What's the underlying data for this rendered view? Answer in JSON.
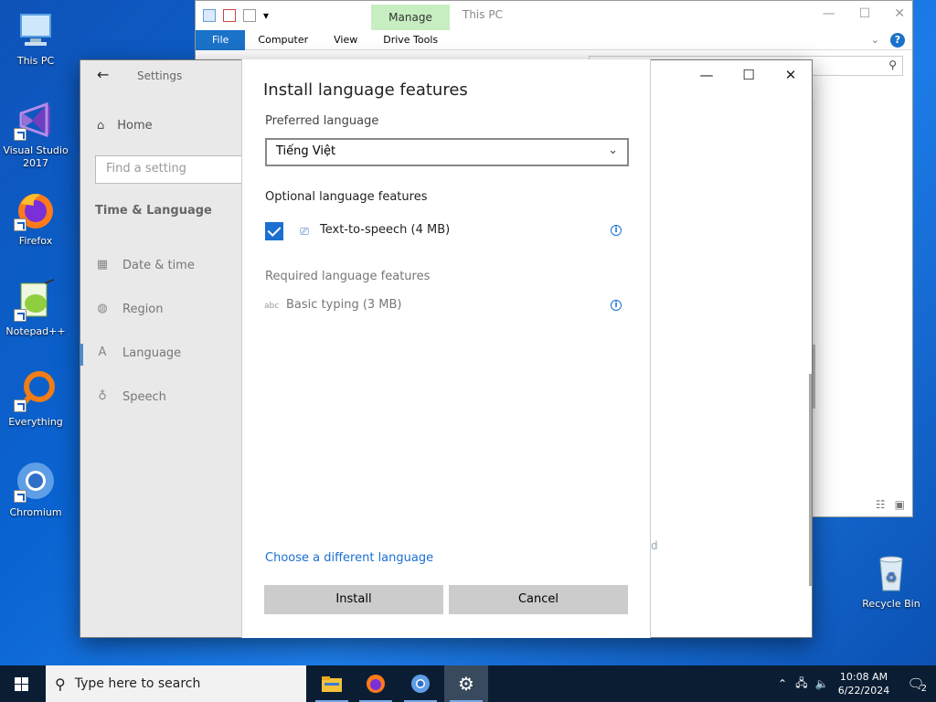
{
  "desktop": {
    "icons": [
      {
        "label": "This PC"
      },
      {
        "label": "Visual Studio 2017"
      },
      {
        "label": "Firefox"
      },
      {
        "label": "Notepad++"
      },
      {
        "label": "Everything"
      },
      {
        "label": "Chromium"
      },
      {
        "label": "Recycle Bin"
      }
    ]
  },
  "explorer": {
    "manage_tab": "Manage",
    "title": "This PC",
    "tabs": [
      "File",
      "Computer",
      "View",
      "Drive Tools"
    ],
    "help": "?"
  },
  "settings": {
    "window_title": "Settings",
    "home": "Home",
    "search_placeholder": "Find a setting",
    "category": "Time & Language",
    "nav": [
      "Date & time",
      "Region",
      "Language",
      "Speech"
    ],
    "selected": "Language",
    "bg_hint": "d"
  },
  "dialog": {
    "title": "Install language features",
    "preferred_label": "Preferred language",
    "preferred_value": "Tiếng Việt",
    "optional_label": "Optional language features",
    "optional_items": [
      {
        "label": "Text-to-speech (4 MB)",
        "checked": true
      }
    ],
    "required_label": "Required language features",
    "required_items": [
      {
        "label": "Basic typing (3 MB)"
      }
    ],
    "link": "Choose a different language",
    "install": "Install",
    "cancel": "Cancel"
  },
  "taskbar": {
    "search_placeholder": "Type here to search",
    "time": "10:08 AM",
    "date": "6/22/2024",
    "notifications": "2"
  },
  "colors": {
    "accent": "#1a6fd1",
    "manage": "#c7eec1",
    "taskbar": "#0b1d33"
  }
}
